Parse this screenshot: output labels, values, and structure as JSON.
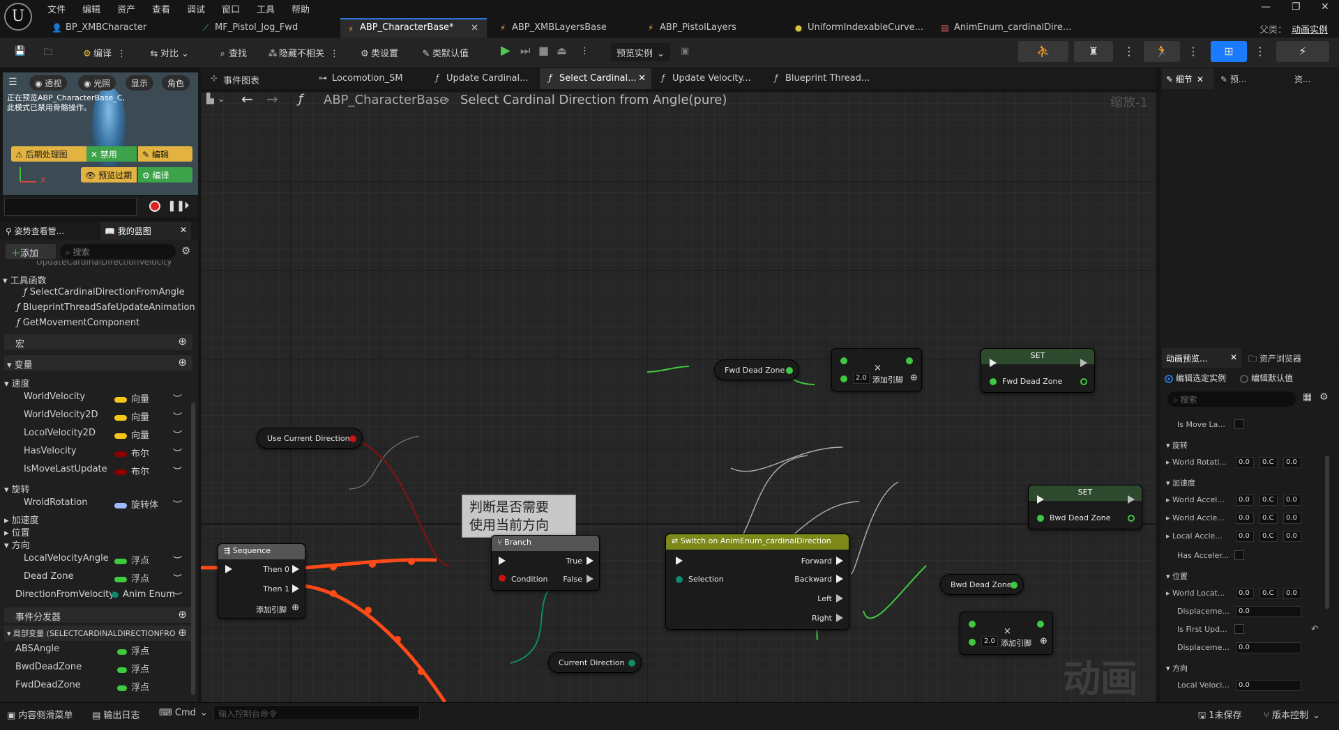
{
  "titlebar": {
    "menu": [
      "文件",
      "编辑",
      "资产",
      "查看",
      "调试",
      "窗口",
      "工具",
      "帮助"
    ],
    "parent_class_label": "父类：",
    "parent_class_value": "动画实例"
  },
  "doc_tabs": [
    {
      "label": "BP_XMBCharacter"
    },
    {
      "label": "MF_Pistol_Jog_Fwd"
    },
    {
      "label": "ABP_CharacterBase*"
    },
    {
      "label": "ABP_XMBLayersBase"
    },
    {
      "label": "ABP_PistolLayers"
    },
    {
      "label": "UniformIndexableCurve..."
    },
    {
      "label": "AnimEnum_cardinalDire..."
    }
  ],
  "toolbar": {
    "compile": "编译",
    "diff": "对比",
    "find": "查找",
    "hide_unrelated": "隐藏不相关",
    "class_settings": "类设置",
    "class_defaults": "类默认值",
    "preview_instance": "预览实例"
  },
  "viewport": {
    "btn_perspective": "透视",
    "btn_lit": "光照",
    "btn_show": "显示",
    "btn_character": "角色",
    "preview_note": "正在预览ABP_CharacterBase_C,\n此模式已禁用骨骼操作。",
    "postprocess": "后期处理图",
    "disable": "禁用",
    "edit": "编辑",
    "preview_expired": "预览过期",
    "compile": "编译"
  },
  "left_tabs": {
    "pose_watch": "姿势查看管...",
    "my_blueprint": "我的蓝图"
  },
  "left_panel": {
    "add_button": "添加",
    "search_placeholder": "搜索",
    "truncated_item": "UpdateCardinalDirectionVelocity",
    "functions_header": "工具函数",
    "functions": [
      "SelectCardinalDirectionFromAngle",
      "BlueprintThreadSafeUpdateAnimation",
      "GetMovementComponent"
    ],
    "macros_header": "宏",
    "variables_header": "变量",
    "groups": {
      "velocity": "速度",
      "rotation": "旋转",
      "acceleration": "加速度",
      "location": "位置",
      "direction": "方向"
    },
    "velocity_vars": [
      {
        "name": "WorldVelocity",
        "type": "向量",
        "color": "#f5c518"
      },
      {
        "name": "WorldVelocity2D",
        "type": "向量",
        "color": "#f5c518"
      },
      {
        "name": "LocolVelocity2D",
        "type": "向量",
        "color": "#f5c518"
      },
      {
        "name": "HasVelocity",
        "type": "布尔",
        "color": "#8b0000"
      },
      {
        "name": "IsMoveLastUpdate",
        "type": "布尔",
        "color": "#8b0000"
      }
    ],
    "rotation_vars": [
      {
        "name": "WroldRotation",
        "type": "旋转体",
        "color": "#9fb8ff"
      }
    ],
    "direction_vars": [
      {
        "name": "LocalVelocityAngle",
        "type": "浮点",
        "color": "#3fc93f"
      },
      {
        "name": "Dead Zone",
        "type": "浮点",
        "color": "#3fc93f"
      },
      {
        "name": "DirectionFromVelocity",
        "type": "Anim Enum",
        "color": "#0e8a6a"
      }
    ],
    "event_dispatchers": "事件分发器",
    "local_vars_header": "局部变量 (SELECTCARDINALDIRECTIONFRO",
    "local_vars": [
      {
        "name": "ABSAngle",
        "type": "浮点",
        "color": "#3fc93f"
      },
      {
        "name": "BwdDeadZone",
        "type": "浮点",
        "color": "#3fc93f"
      },
      {
        "name": "FwdDeadZone",
        "type": "浮点",
        "color": "#3fc93f"
      }
    ]
  },
  "graph_tabs": [
    {
      "label": "事件图表"
    },
    {
      "label": "Locomotion_SM"
    },
    {
      "label": "Update Cardinal..."
    },
    {
      "label": "Select Cardinal..."
    },
    {
      "label": "Update Velocity..."
    },
    {
      "label": "Blueprint Thread..."
    }
  ],
  "breadcrumb": {
    "root": "ABP_CharacterBase",
    "current": "Select Cardinal Direction from Angle(pure)",
    "zoom": "缩放-1"
  },
  "graph": {
    "comment": "判断是否需要\n使用当前方向",
    "use_current_direction": "Use Current Direction",
    "sequence_title": "Sequence",
    "then0": "Then 0",
    "then1": "Then 1",
    "add_pin": "添加引脚",
    "branch_title": "Branch",
    "condition": "Condition",
    "true_label": "True",
    "false_label": "False",
    "switch_title": "Switch on AnimEnum_cardinalDirection",
    "selection": "Selection",
    "forward": "Forward",
    "backward": "Backward",
    "left": "Left",
    "right": "Right",
    "current_direction": "Current Direction",
    "fwd_dead_zone_get": "Fwd Dead Zone",
    "bwd_dead_zone_get": "Bwd Dead Zone",
    "multiply_value": "2.0",
    "multiply_value_2": "2.0",
    "set_title": "SET",
    "set_fwd_label": "Fwd Dead Zone",
    "set_bwd_label": "Bwd Dead Zone",
    "watermark": "动画"
  },
  "right_panel": {
    "details_tab": "细节",
    "preview_tab": "预...",
    "assets_tab": "资...",
    "anim_preview_tab": "动画预览...",
    "asset_browser_tab": "资产浏览器",
    "radio_selected": "编辑选定实例",
    "radio_defaults": "编辑默认值",
    "search_placeholder": "搜索",
    "is_move_la": "Is Move La...",
    "rotation": "旋转",
    "world_rotation": "World Rotati...",
    "acceleration": "加速度",
    "world_accel_1": "World Accel...",
    "world_accel_2": "World Accle...",
    "local_accel": "Local Accle...",
    "has_accel": "Has Acceler...",
    "location": "位置",
    "world_location": "World Locat...",
    "displacement_1": "Displaceme...",
    "is_first_update": "Is First Upd...",
    "displacement_2": "Displaceme...",
    "direction": "方向",
    "local_velocity": "Local Veloci...",
    "zero": "0.0",
    "zero_short": "0.C"
  },
  "statusbar": {
    "content_drawer": "内容侧滑菜单",
    "output_log": "输出日志",
    "cmd": "Cmd",
    "console_placeholder": "输入控制台命令",
    "unsaved": "1未保存",
    "source_control": "版本控制"
  }
}
